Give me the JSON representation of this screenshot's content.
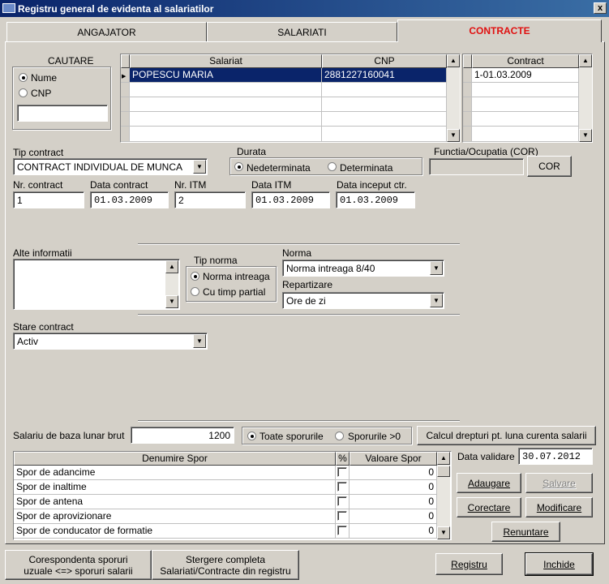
{
  "window": {
    "title": "Registru general de evidenta al salariatilor",
    "close": "x"
  },
  "tabs": [
    "ANGAJATOR",
    "SALARIATI",
    "CONTRACTE"
  ],
  "search": {
    "label": "CAUTARE",
    "opt1": "Nume",
    "opt2": "CNP",
    "value": ""
  },
  "emp_grid": {
    "col1": "Salariat",
    "col2": "CNP",
    "rows": [
      {
        "name": "POPESCU MARIA",
        "cnp": "2881227160041"
      }
    ]
  },
  "contract_grid": {
    "col": "Contract",
    "rows": [
      "1-01.03.2009"
    ]
  },
  "tip_contract": {
    "label": "Tip contract",
    "value": "CONTRACT INDIVIDUAL DE MUNCA"
  },
  "durata": {
    "label": "Durata",
    "opt1": "Nedeterminata",
    "opt2": "Determinata"
  },
  "functia": {
    "label": "Functia/Ocupatia (COR)",
    "value": "",
    "btn": "COR"
  },
  "fields": {
    "nr_contract_label": "Nr. contract",
    "nr_contract": "1",
    "data_contract_label": "Data contract",
    "data_contract": "01.03.2009",
    "nr_itm_label": "Nr. ITM",
    "nr_itm": "2",
    "data_itm_label": "Data ITM",
    "data_itm": "01.03.2009",
    "data_inceput_label": "Data inceput ctr.",
    "data_inceput": "01.03.2009"
  },
  "alte": {
    "label": "Alte informatii",
    "value": ""
  },
  "tip_norma": {
    "label": "Tip norma",
    "opt1": "Norma intreaga",
    "opt2": "Cu timp partial"
  },
  "norma": {
    "label": "Norma",
    "value": "Norma intreaga 8/40"
  },
  "repartizare": {
    "label": "Repartizare",
    "value": "Ore de zi"
  },
  "stare": {
    "label": "Stare contract",
    "value": "Activ"
  },
  "salariu": {
    "label": "Salariu de baza lunar brut",
    "value": "1200",
    "opt1": "Toate sporurile",
    "opt2": "Sporurile >0",
    "calc_btn": "Calcul drepturi pt. luna curenta salarii"
  },
  "spor_grid": {
    "col1": "Denumire Spor",
    "col2": "%",
    "col3": "Valoare Spor",
    "rows": [
      {
        "name": "Spor de adancime",
        "val": "0"
      },
      {
        "name": "Spor de inaltime",
        "val": "0"
      },
      {
        "name": "Spor de antena",
        "val": "0"
      },
      {
        "name": "Spor de aprovizionare",
        "val": "0"
      },
      {
        "name": "Spor de conducator de formatie",
        "val": "0"
      }
    ]
  },
  "validare": {
    "label": "Data validare",
    "value": "30.07.2012"
  },
  "buttons": {
    "adaugare": "Adaugare",
    "salvare": "Salvare",
    "corectare": "Corectare",
    "modificare": "Modificare",
    "renuntare": "Renuntare",
    "corespondenta1": "Corespondenta sporuri",
    "corespondenta2": "uzuale <=> sporuri salarii",
    "stergere1": "Stergere completa",
    "stergere2": "Salariati/Contracte din registru",
    "registru": "Registru",
    "inchide": "Inchide"
  }
}
